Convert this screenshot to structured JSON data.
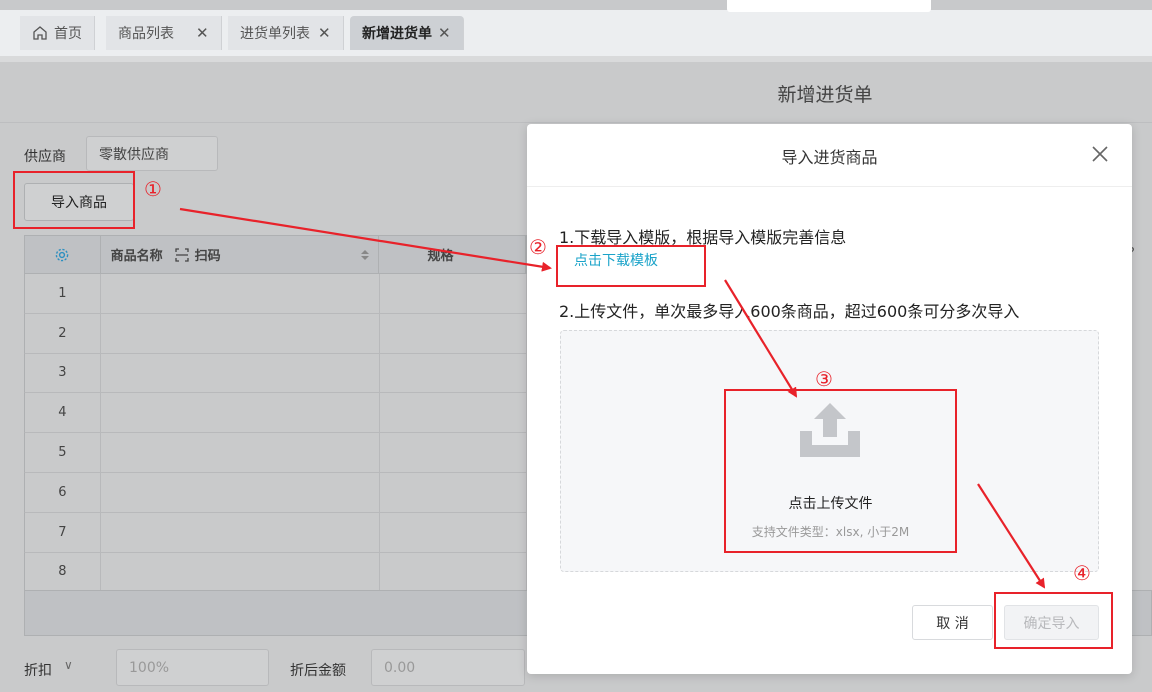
{
  "tabs": [
    {
      "label": "首页",
      "icon": "home-icon"
    },
    {
      "label": "商品列表"
    },
    {
      "label": "进货单列表"
    },
    {
      "label": "新增进货单"
    }
  ],
  "page": {
    "title": "新增进货单",
    "supplier_label": "供应商",
    "supplier_value": "零散供应商",
    "import_button": "导入商品",
    "table": {
      "headers": [
        "商品名称",
        "扫码",
        "规格"
      ],
      "row_numbers": [
        "1",
        "2",
        "3",
        "4",
        "5",
        "6",
        "7",
        "8"
      ]
    },
    "discount_label": "折扣",
    "discount_placeholder": "100%",
    "after_discount_label": "折后金额",
    "after_discount_placeholder": "0.00"
  },
  "modal": {
    "title": "导入进货商品",
    "step1": "1.下载导入模版，根据导入模版完善信息",
    "download_link": "点击下载模板",
    "step2": "2.上传文件，单次最多导入600条商品，超过600条可分多次导入",
    "upload_text": "点击上传文件",
    "upload_hint": "支持文件类型：xlsx, 小于2M",
    "cancel": "取 消",
    "confirm": "确定导入"
  },
  "annotations": [
    "①",
    "②",
    "③",
    "④"
  ],
  "colors": {
    "annotation": "#e8222a",
    "link": "#1aa3c9"
  }
}
